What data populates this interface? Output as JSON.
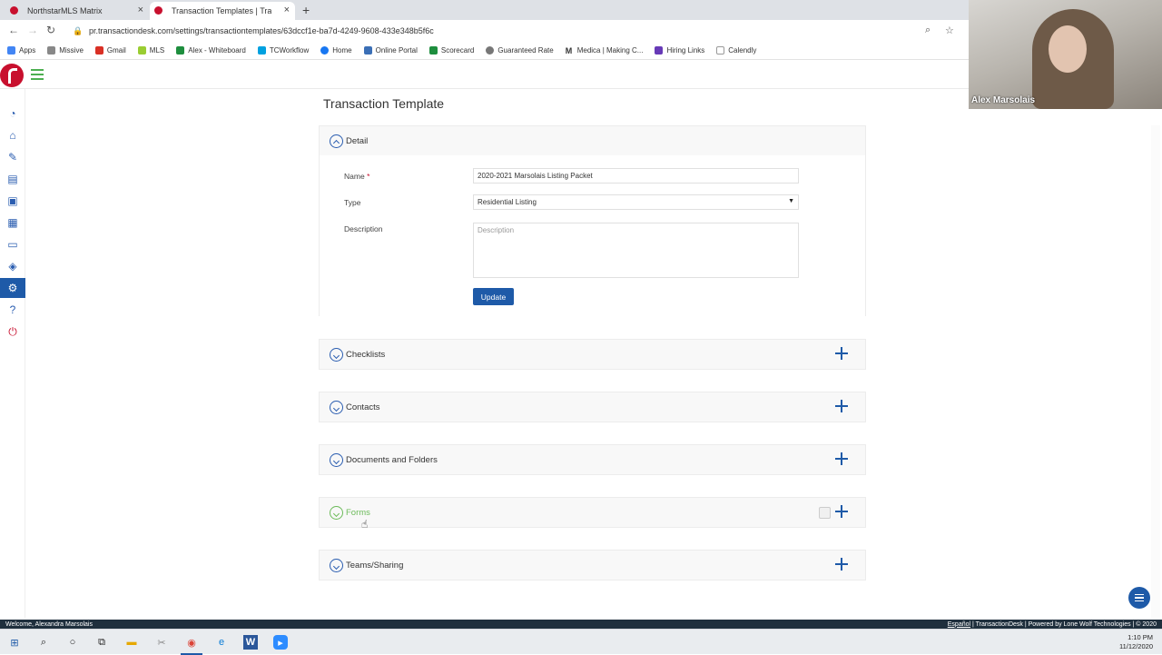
{
  "browser": {
    "tabs": [
      {
        "label": "NorthstarMLS Matrix",
        "active": false
      },
      {
        "label": "Transaction Templates | Transacti",
        "active": true
      }
    ],
    "url": "pr.transactiondesk.com/settings/transactiontemplates/63dccf1e-ba7d-4249-9608-433e348b5f6c",
    "bookmarks": [
      "Apps",
      "Missive",
      "Gmail",
      "MLS",
      "Alex - Whiteboard",
      "TCWorkflow",
      "Home",
      "Online Portal",
      "Scorecard",
      "Guaranteed Rate",
      "Medica | Making C...",
      "Hiring Links",
      "Calendly"
    ]
  },
  "page": {
    "title": "Transaction Template"
  },
  "detail": {
    "header": "Detail",
    "name_label": "Name",
    "name_required": "*",
    "name_value": "2020-2021 Marsolais Listing Packet",
    "type_label": "Type",
    "type_value": "Residential Listing",
    "description_label": "Description",
    "description_placeholder": "Description",
    "update_button": "Update"
  },
  "sections": {
    "checklists": "Checklists",
    "contacts": "Contacts",
    "documents": "Documents and Folders",
    "forms": "Forms",
    "teams": "Teams/Sharing"
  },
  "webcam": {
    "name": "Alex Marsolais"
  },
  "footer": {
    "welcome": "Welcome, Alexandra Marsolais",
    "lang_link": "Español",
    "brand": "| TransactionDesk | Powered by Lone Wolf Technologies | © 2020"
  },
  "taskbar": {
    "time": "1:10 PM",
    "date": "11/12/2020"
  },
  "colors": {
    "brand_red": "#c8102e",
    "primary_blue": "#1e5aa8",
    "forms_green": "#6cbb5a"
  }
}
